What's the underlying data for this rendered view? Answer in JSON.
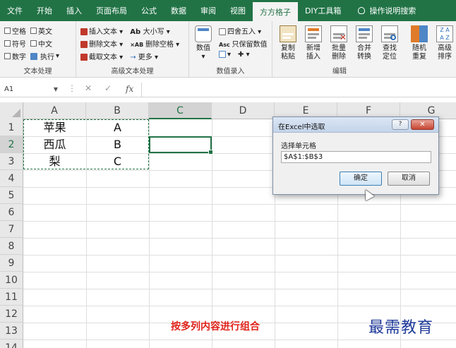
{
  "tabs": [
    {
      "label": "文件",
      "active": false
    },
    {
      "label": "开始",
      "active": false
    },
    {
      "label": "插入",
      "active": false
    },
    {
      "label": "页面布局",
      "active": false
    },
    {
      "label": "公式",
      "active": false
    },
    {
      "label": "数据",
      "active": false
    },
    {
      "label": "审阅",
      "active": false
    },
    {
      "label": "视图",
      "active": false
    },
    {
      "label": "方方格子",
      "active": true
    },
    {
      "label": "DIY工具箱",
      "active": false
    }
  ],
  "help_label": "操作说明搜索",
  "ribbon": {
    "text_processing": {
      "label": "文本处理",
      "checks": [
        "空格",
        "英文",
        "符号",
        "中文",
        "数字"
      ],
      "exec": "执行"
    },
    "advanced_text": {
      "label": "高级文本处理",
      "insert_text": "插入文本",
      "delete_text": "删除文本",
      "extract_text": "截取文本",
      "case": "大小写",
      "delete_space": "删除空格",
      "more": "更多"
    },
    "value_entry": {
      "label": "数值录入",
      "value": "数值",
      "round": "四舍五入",
      "keep_value": "只保留数值"
    },
    "edit": {
      "label": "编辑",
      "buttons": [
        "复制粘贴",
        "新增插入",
        "批量删除",
        "合并转换",
        "查找定位",
        "随机重复",
        "高级排序"
      ]
    }
  },
  "formula_bar": {
    "name_box": "A1",
    "fx": "fx"
  },
  "columns": [
    "A",
    "B",
    "C",
    "D",
    "E",
    "F",
    "G"
  ],
  "rows": [
    "1",
    "2",
    "3",
    "4",
    "5",
    "6",
    "7",
    "8",
    "9",
    "10",
    "11",
    "12",
    "13",
    "14"
  ],
  "cells": {
    "A1": "苹果",
    "B1": "A",
    "A2": "西瓜",
    "B2": "B",
    "A3": "梨",
    "B3": "C"
  },
  "dialog": {
    "title": "在Excel中选取",
    "help": "?",
    "close": "✕",
    "label": "选择单元格",
    "value": "$A$1:$B$3",
    "ok": "确定",
    "cancel": "取消"
  },
  "caption": "按多列内容进行组合",
  "watermark": "最需教育",
  "colors": {
    "ribbon_green": "#217346",
    "caption_red": "#e0241b",
    "watermark_blue": "#1f3a9a"
  }
}
